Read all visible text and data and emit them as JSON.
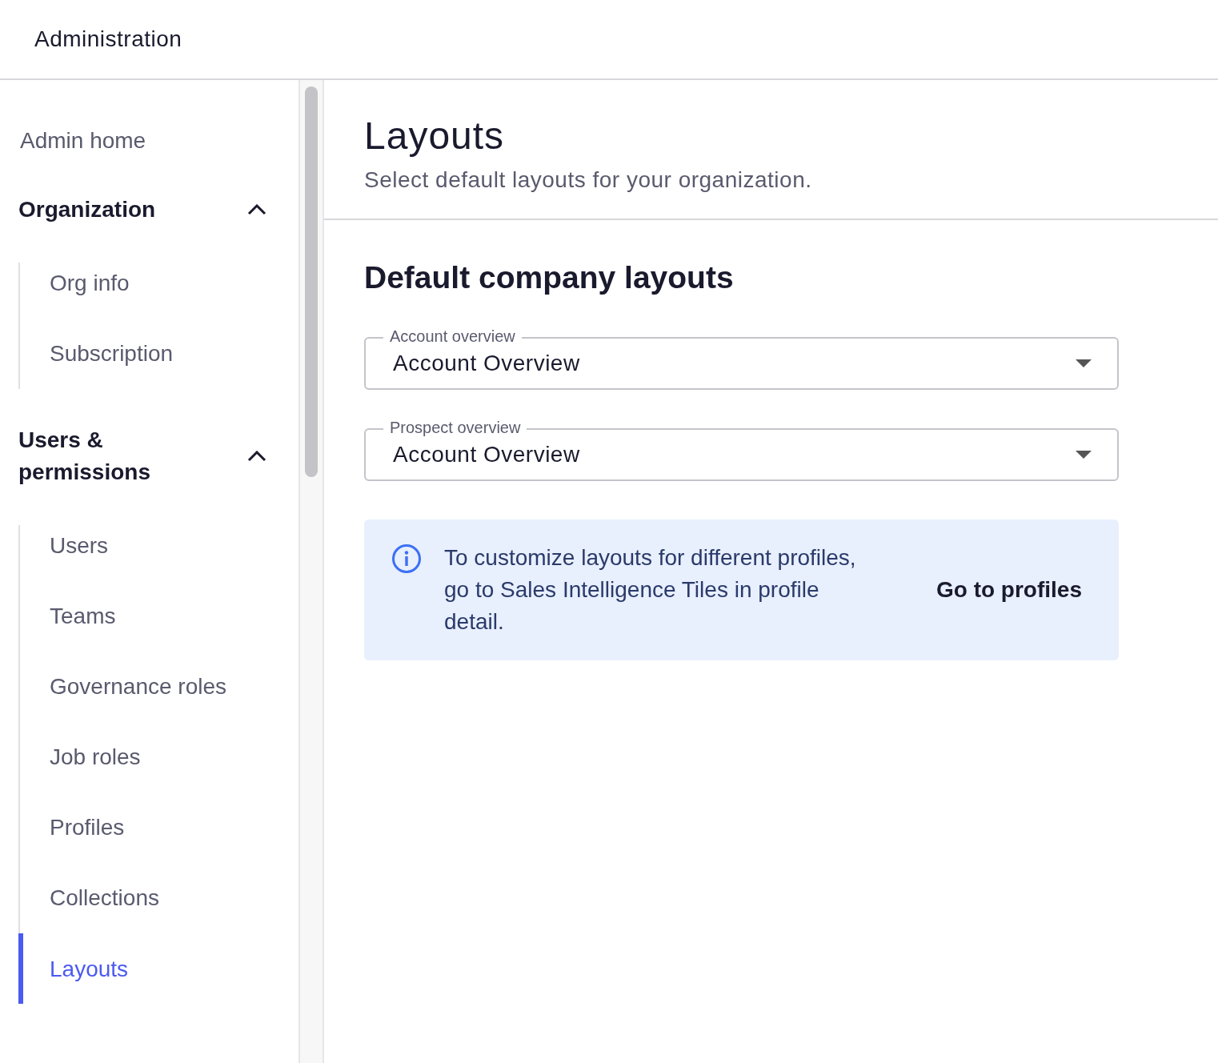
{
  "header": {
    "title": "Administration"
  },
  "sidebar": {
    "items": [
      {
        "kind": "link",
        "label": "Admin home",
        "selected": false
      },
      {
        "kind": "group",
        "label": "Organization",
        "expanded": true,
        "children": [
          {
            "label": "Org info",
            "selected": false
          },
          {
            "label": "Subscription",
            "selected": false
          }
        ]
      },
      {
        "kind": "group",
        "label": "Users & permissions",
        "expanded": true,
        "children": [
          {
            "label": "Users",
            "selected": false
          },
          {
            "label": "Teams",
            "selected": false
          },
          {
            "label": "Governance roles",
            "selected": false
          },
          {
            "label": "Job roles",
            "selected": false
          },
          {
            "label": "Profiles",
            "selected": false
          },
          {
            "label": "Collections",
            "selected": false
          },
          {
            "label": "Layouts",
            "selected": true
          }
        ]
      }
    ]
  },
  "page": {
    "title": "Layouts",
    "subtitle": "Select default layouts for your organization."
  },
  "section": {
    "title": "Default company layouts",
    "fields": [
      {
        "label": "Account overview",
        "value": "Account Overview"
      },
      {
        "label": "Prospect overview",
        "value": "Account Overview"
      }
    ]
  },
  "info_banner": {
    "text": "To customize layouts for different profiles, go to Sales Intelligence Tiles in profile detail.",
    "action": "Go to profiles"
  }
}
